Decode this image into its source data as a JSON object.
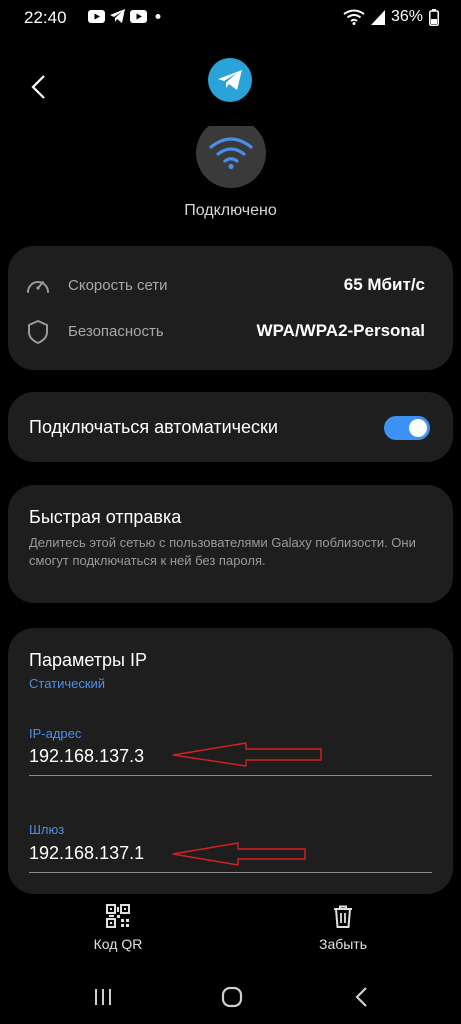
{
  "status_bar": {
    "time": "22:40",
    "battery": "36%",
    "app_icons": [
      "youtube-icon",
      "telegram-icon",
      "youtube-icon",
      "dot-icon"
    ]
  },
  "header": {
    "status": "Подключено"
  },
  "info": {
    "speed_label": "Скорость сети",
    "speed_value": "65 Мбит/с",
    "security_label": "Безопасность",
    "security_value": "WPA/WPA2-Personal"
  },
  "auto_connect": {
    "label": "Подключаться автоматически",
    "enabled": true
  },
  "quick_share": {
    "title": "Быстрая отправка",
    "description": "Делитесь этой сетью с пользователями Galaxy поблизости. Они смогут подключаться к ней без пароля."
  },
  "ip_settings": {
    "title": "Параметры IP",
    "mode": "Статический",
    "ip_label": "IP-адрес",
    "ip_value": "192.168.137.3",
    "gateway_label": "Шлюз",
    "gateway_value": "192.168.137.1"
  },
  "bottom_actions": {
    "qr_label": "Код QR",
    "forget_label": "Забыть"
  },
  "colors": {
    "accent": "#3e91f5",
    "card": "#1e1e1e",
    "annotation_arrow": "#d42020"
  }
}
